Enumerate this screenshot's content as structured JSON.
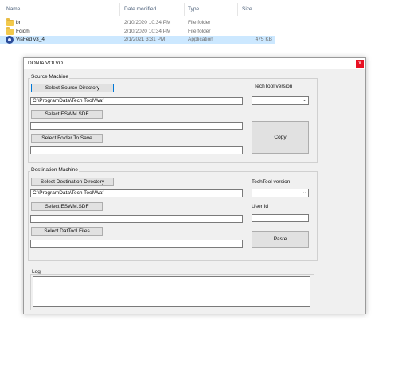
{
  "explorer": {
    "columns": {
      "name": "Name",
      "date_modified": "Date modified",
      "type": "Type",
      "size": "Size"
    },
    "rows": [
      {
        "name": "bn",
        "date": "2/10/2020 10:34 PM",
        "type": "File folder",
        "size": "",
        "icon": "folder-icon"
      },
      {
        "name": "Fciom",
        "date": "2/10/2020 10:34 PM",
        "type": "File folder",
        "size": "",
        "icon": "folder-icon"
      },
      {
        "name": "VisFed v3_4",
        "date": "2/1/2021 3:31 PM",
        "type": "Application",
        "size": "475 KB",
        "icon": "app-icon"
      }
    ]
  },
  "dialog": {
    "title": "DONIA VOLVO",
    "close": "x",
    "source": {
      "group_label": "Source Machine",
      "select_source_dir": "Select Source Directory",
      "source_path": "C:\\ProgramData\\Tech Tool\\Waf",
      "select_eswm": "Select ESWM.SDF",
      "eswm_value": "",
      "select_folder": "Select Folder To Save",
      "folder_value": "",
      "techtool_label": "TechTool version",
      "techtool_value": "",
      "copy": "Copy"
    },
    "destination": {
      "group_label": "Destination Machine",
      "select_dest_dir": "Select Destination Directory",
      "dest_path": "C:\\ProgramData\\Tech Tool\\Waf",
      "select_eswm": "Select ESWM.SDF",
      "eswm_value": "",
      "select_dattool": "Select DatTool Files",
      "dattool_value": "",
      "techtool_label": "TechTool version",
      "techtool_value": "",
      "userid_label": "User Id",
      "userid_value": "",
      "paste": "Paste"
    },
    "log": {
      "group_label": "Log",
      "content": ""
    }
  },
  "colors": {
    "selection": "#cce8ff",
    "accent": "#0078d7",
    "close": "#e81123",
    "window_bg": "#f0f0f0"
  }
}
